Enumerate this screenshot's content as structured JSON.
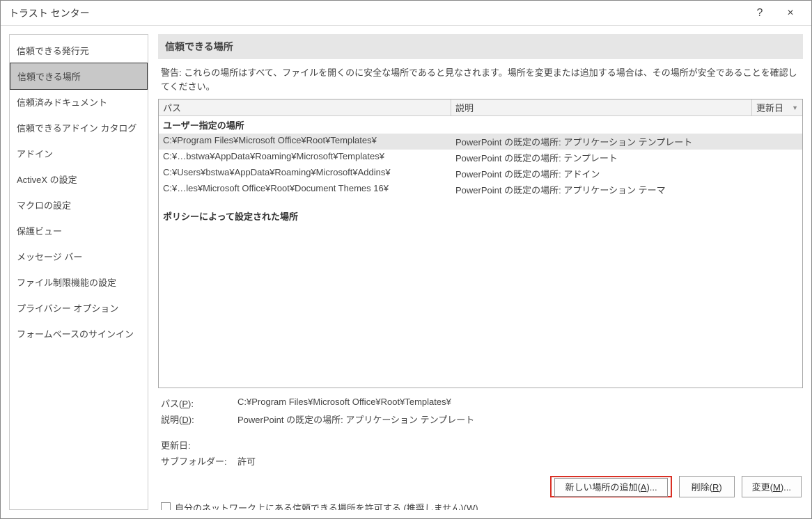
{
  "titlebar": {
    "title": "トラスト センター",
    "help": "?",
    "close": "×"
  },
  "sidebar": {
    "items": [
      {
        "label": "信頼できる発行元"
      },
      {
        "label": "信頼できる場所"
      },
      {
        "label": "信頼済みドキュメント"
      },
      {
        "label": "信頼できるアドイン カタログ"
      },
      {
        "label": "アドイン"
      },
      {
        "label": "ActiveX の設定"
      },
      {
        "label": "マクロの設定"
      },
      {
        "label": "保護ビュー"
      },
      {
        "label": "メッセージ バー"
      },
      {
        "label": "ファイル制限機能の設定"
      },
      {
        "label": "プライバシー オプション"
      },
      {
        "label": "フォームベースのサインイン"
      }
    ],
    "selected_index": 1
  },
  "main": {
    "section_title": "信頼できる場所",
    "warning_text": "警告: これらの場所はすべて、ファイルを開くのに安全な場所であると見なされます。場所を変更または追加する場合は、その場所が安全であることを確認してください。",
    "columns": {
      "path": "パス",
      "desc": "説明",
      "date": "更新日"
    },
    "group_user": "ユーザー指定の場所",
    "rows": [
      {
        "path": "C:¥Program Files¥Microsoft Office¥Root¥Templates¥",
        "desc": "PowerPoint の既定の場所: アプリケーション テンプレート",
        "date": ""
      },
      {
        "path": "C:¥…bstwa¥AppData¥Roaming¥Microsoft¥Templates¥",
        "desc": "PowerPoint の既定の場所: テンプレート",
        "date": ""
      },
      {
        "path": "C:¥Users¥bstwa¥AppData¥Roaming¥Microsoft¥Addins¥",
        "desc": "PowerPoint の既定の場所: アドイン",
        "date": ""
      },
      {
        "path": "C:¥…les¥Microsoft Office¥Root¥Document Themes 16¥",
        "desc": "PowerPoint の既定の場所: アプリケーション テーマ",
        "date": ""
      }
    ],
    "selected_row_index": 0,
    "group_policy": "ポリシーによって設定された場所",
    "details": {
      "path_label": "パス(P):",
      "path_value": "C:¥Program Files¥Microsoft Office¥Root¥Templates¥",
      "desc_label": "説明(D):",
      "desc_value": "PowerPoint の既定の場所: アプリケーション テンプレート",
      "date_label": "更新日:",
      "date_value": "",
      "subfolder_label": "サブフォルダー:",
      "subfolder_value": "許可"
    },
    "buttons": {
      "add": "新しい場所の追加(A)...",
      "remove": "削除(R)",
      "modify": "変更(M)..."
    },
    "checkbox_network": "自分のネットワーク上にある信頼できる場所を許可する (推奨しません)(W)"
  }
}
